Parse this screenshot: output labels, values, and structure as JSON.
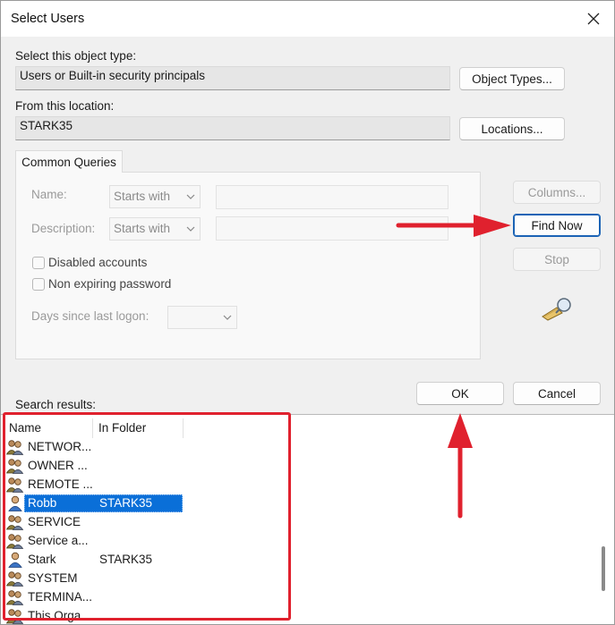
{
  "window": {
    "title": "Select Users"
  },
  "object_type": {
    "label": "Select this object type:",
    "value": "Users or Built-in security principals",
    "button": "Object Types..."
  },
  "location": {
    "label": "From this location:",
    "value": "STARK35",
    "button": "Locations..."
  },
  "tab": {
    "label": "Common Queries"
  },
  "query": {
    "name_label": "Name:",
    "name_mode": "Starts with",
    "desc_label": "Description:",
    "desc_mode": "Starts with",
    "disabled_accounts": "Disabled accounts",
    "non_expiring": "Non expiring password",
    "days_label": "Days since last logon:"
  },
  "side_buttons": {
    "columns": "Columns...",
    "find_now": "Find Now",
    "stop": "Stop"
  },
  "footer": {
    "search_results_label": "Search results:",
    "ok": "OK",
    "cancel": "Cancel"
  },
  "results": {
    "columns": [
      "Name",
      "In Folder"
    ],
    "rows": [
      {
        "name": "NETWOR...",
        "folder": "",
        "icon": "group-icon"
      },
      {
        "name": "OWNER ...",
        "folder": "",
        "icon": "group-icon"
      },
      {
        "name": "REMOTE ...",
        "folder": "",
        "icon": "group-icon"
      },
      {
        "name": "Robb",
        "folder": "STARK35",
        "icon": "user-icon",
        "selected": true
      },
      {
        "name": "SERVICE",
        "folder": "",
        "icon": "group-icon"
      },
      {
        "name": "Service a...",
        "folder": "",
        "icon": "group-icon"
      },
      {
        "name": "Stark",
        "folder": "STARK35",
        "icon": "user-icon"
      },
      {
        "name": "SYSTEM",
        "folder": "",
        "icon": "group-icon"
      },
      {
        "name": "TERMINA...",
        "folder": "",
        "icon": "group-icon"
      },
      {
        "name": "This Orga...",
        "folder": "",
        "icon": "group-icon"
      }
    ]
  },
  "annotation_color": "#e0212e",
  "accent_color": "#1b63b5"
}
